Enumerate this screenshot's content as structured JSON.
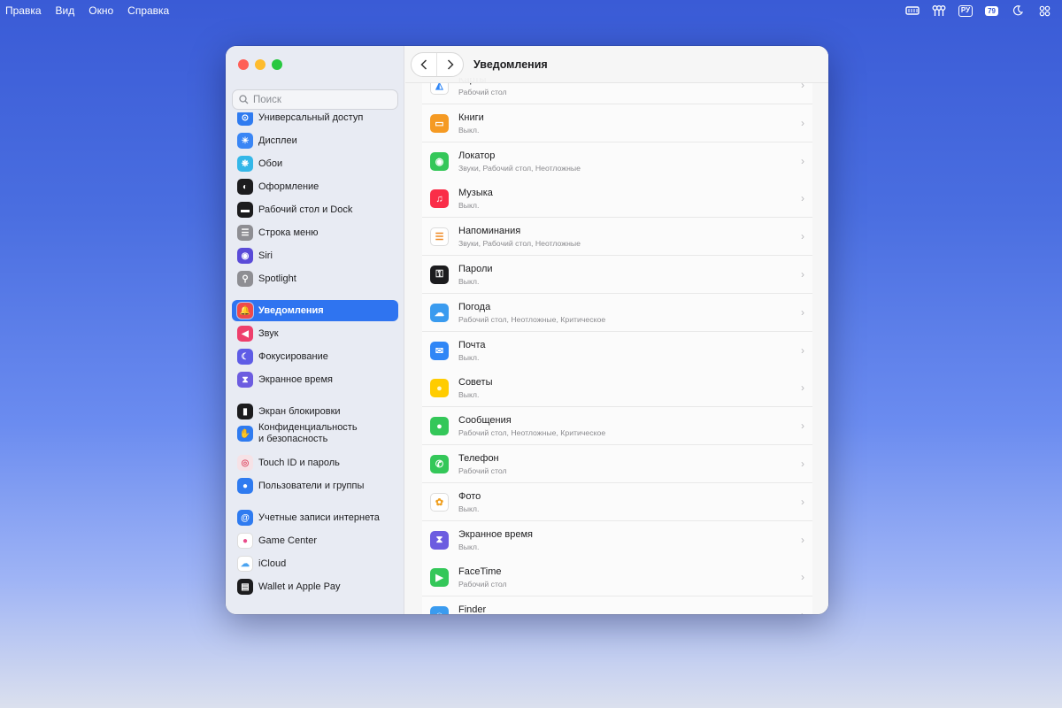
{
  "menubar": {
    "items": [
      "Правка",
      "Вид",
      "Окно",
      "Справка"
    ],
    "input_lang": "РУ",
    "battery": "79"
  },
  "sidebar": {
    "search_placeholder": "Поиск",
    "items": [
      {
        "label": "Универсальный доступ",
        "icon": "accessibility-icon",
        "color": "#2f7bf0"
      },
      {
        "label": "Дисплеи",
        "icon": "display-icon",
        "color": "#3a86f5"
      },
      {
        "label": "Обои",
        "icon": "wallpaper-icon",
        "color": "#34b7e8"
      },
      {
        "label": "Оформление",
        "icon": "appearance-icon",
        "color": "#1c1c1e"
      },
      {
        "label": "Рабочий стол и Dock",
        "icon": "dock-icon",
        "color": "#1c1c1e"
      },
      {
        "label": "Строка меню",
        "icon": "menubar-icon",
        "color": "#8e8e93"
      },
      {
        "label": "Siri",
        "icon": "siri-icon",
        "color": "#5a4bd8"
      },
      {
        "label": "Spotlight",
        "icon": "spotlight-icon",
        "color": "#8e8e93"
      },
      {
        "label": "Уведомления",
        "icon": "bell-icon",
        "color": "#f04a4a"
      },
      {
        "label": "Звук",
        "icon": "speaker-icon",
        "color": "#ee3f6c"
      },
      {
        "label": "Фокусирование",
        "icon": "moon-icon",
        "color": "#5e5ce6"
      },
      {
        "label": "Экранное время",
        "icon": "hourglass-icon",
        "color": "#6c5ce0"
      },
      {
        "label": "Экран блокировки",
        "icon": "lock-icon",
        "color": "#1c1c1e"
      },
      {
        "label": "Конфиденциальность\nи безопасность",
        "icon": "hand-icon",
        "color": "#2f7bf0"
      },
      {
        "label": "Touch ID и пароль",
        "icon": "fingerprint-icon",
        "color": "#f6e2e6"
      },
      {
        "label": "Пользователи и группы",
        "icon": "users-icon",
        "color": "#2f7bf0"
      },
      {
        "label": "Учетные записи интернета",
        "icon": "at-icon",
        "color": "#2f7bf0"
      },
      {
        "label": "Game Center",
        "icon": "gamecenter-icon",
        "color": "#ffffff"
      },
      {
        "label": "iCloud",
        "icon": "icloud-icon",
        "color": "#ffffff"
      },
      {
        "label": "Wallet и Apple Pay",
        "icon": "wallet-icon",
        "color": "#1c1c1e"
      }
    ]
  },
  "main": {
    "title": "Уведомления",
    "apps": [
      {
        "name": "Карты",
        "sub": "Рабочий стол",
        "icon": "maps-icon",
        "color": "#ffffff"
      },
      {
        "name": "Книги",
        "sub": "Выкл.",
        "icon": "books-icon",
        "color": "#f59a23"
      },
      {
        "name": "Локатор",
        "sub": "Звуки, Рабочий стол, Неотложные",
        "icon": "findmy-icon",
        "color": "#34c759"
      },
      {
        "name": "Музыка",
        "sub": "Выкл.",
        "icon": "music-icon",
        "color": "#fa2d48"
      },
      {
        "name": "Напоминания",
        "sub": "Звуки, Рабочий стол, Неотложные",
        "icon": "reminders-icon",
        "color": "#ffffff"
      },
      {
        "name": "Пароли",
        "sub": "Выкл.",
        "icon": "passwords-icon",
        "color": "#1c1c1e"
      },
      {
        "name": "Погода",
        "sub": "Рабочий стол, Неотложные, Критическое",
        "icon": "weather-icon",
        "color": "#3a9bef"
      },
      {
        "name": "Почта",
        "sub": "Выкл.",
        "icon": "mail-icon",
        "color": "#2f86f6"
      },
      {
        "name": "Советы",
        "sub": "Выкл.",
        "icon": "tips-icon",
        "color": "#ffcc00"
      },
      {
        "name": "Сообщения",
        "sub": "Рабочий стол, Неотложные, Критическое",
        "icon": "messages-icon",
        "color": "#34c759"
      },
      {
        "name": "Телефон",
        "sub": "Рабочий стол",
        "icon": "phone-icon",
        "color": "#34c759"
      },
      {
        "name": "Фото",
        "sub": "Выкл.",
        "icon": "photos-icon",
        "color": "#ffffff"
      },
      {
        "name": "Экранное время",
        "sub": "Выкл.",
        "icon": "screentime-icon",
        "color": "#6c5ce0"
      },
      {
        "name": "FaceTime",
        "sub": "Рабочий стол",
        "icon": "facetime-icon",
        "color": "#34c759"
      },
      {
        "name": "Finder",
        "sub": "",
        "icon": "finder-icon",
        "color": "#3a9bef"
      }
    ]
  }
}
